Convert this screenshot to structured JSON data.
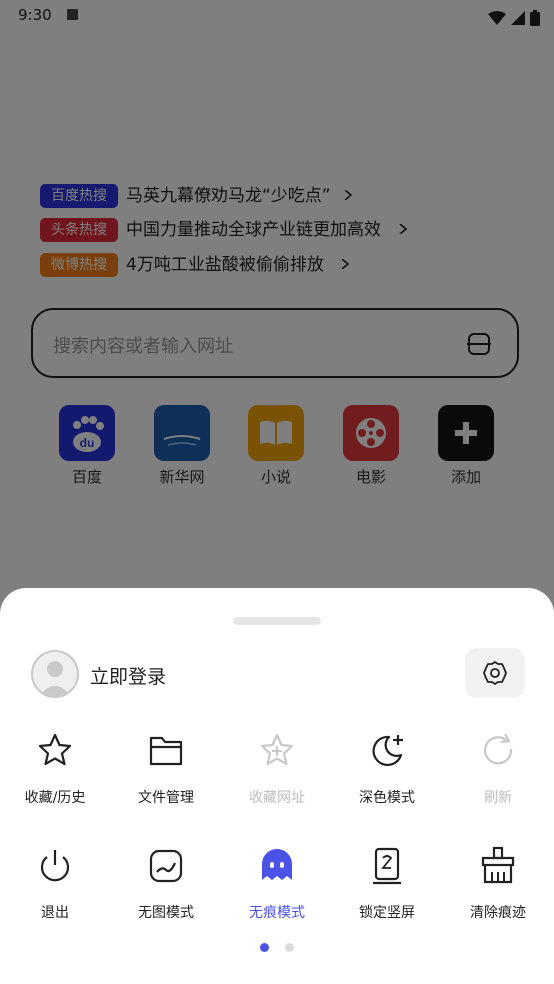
{
  "status_bar": {
    "time": "9:30"
  },
  "hot_searches": [
    {
      "tag": "百度热搜",
      "color": "#2b33e0",
      "title": "马英九幕僚劝马龙“少吃点”"
    },
    {
      "tag": "头条热搜",
      "color": "#e02a3b",
      "title": "中国力量推动全球产业链更加高效"
    },
    {
      "tag": "微博热搜",
      "color": "#f57f17",
      "title": "4万吨工业盐酸被偷偷排放"
    }
  ],
  "search": {
    "placeholder": "搜索内容或者输入网址"
  },
  "shortcuts": [
    {
      "label": "百度",
      "color": "#2932e1"
    },
    {
      "label": "新华网",
      "color": "#1d5fb0"
    },
    {
      "label": "小说",
      "color": "#f3a40b"
    },
    {
      "label": "电影",
      "color": "#e53b3b"
    },
    {
      "label": "添加",
      "color": "#151515"
    }
  ],
  "sheet": {
    "login_label": "立即登录",
    "menu_page1_row1": [
      {
        "label": "收藏/历史",
        "icon": "star-icon",
        "enabled": true
      },
      {
        "label": "文件管理",
        "icon": "folder-icon",
        "enabled": true
      },
      {
        "label": "收藏网址",
        "icon": "star-plus-icon",
        "enabled": false
      },
      {
        "label": "深色模式",
        "icon": "moon-icon",
        "enabled": true
      },
      {
        "label": "刷新",
        "icon": "refresh-icon",
        "enabled": false
      }
    ],
    "menu_page1_row2": [
      {
        "label": "退出",
        "icon": "power-icon",
        "enabled": true
      },
      {
        "label": "无图模式",
        "icon": "no-image-icon",
        "enabled": true
      },
      {
        "label": "无痕模式",
        "icon": "ghost-icon",
        "enabled": true,
        "active": true
      },
      {
        "label": "锁定竖屏",
        "icon": "lock-portrait-icon",
        "enabled": true
      },
      {
        "label": "清除痕迹",
        "icon": "broom-icon",
        "enabled": true
      }
    ],
    "pagination": {
      "current": 1,
      "total": 2
    },
    "accent_color": "#4a52e8"
  }
}
